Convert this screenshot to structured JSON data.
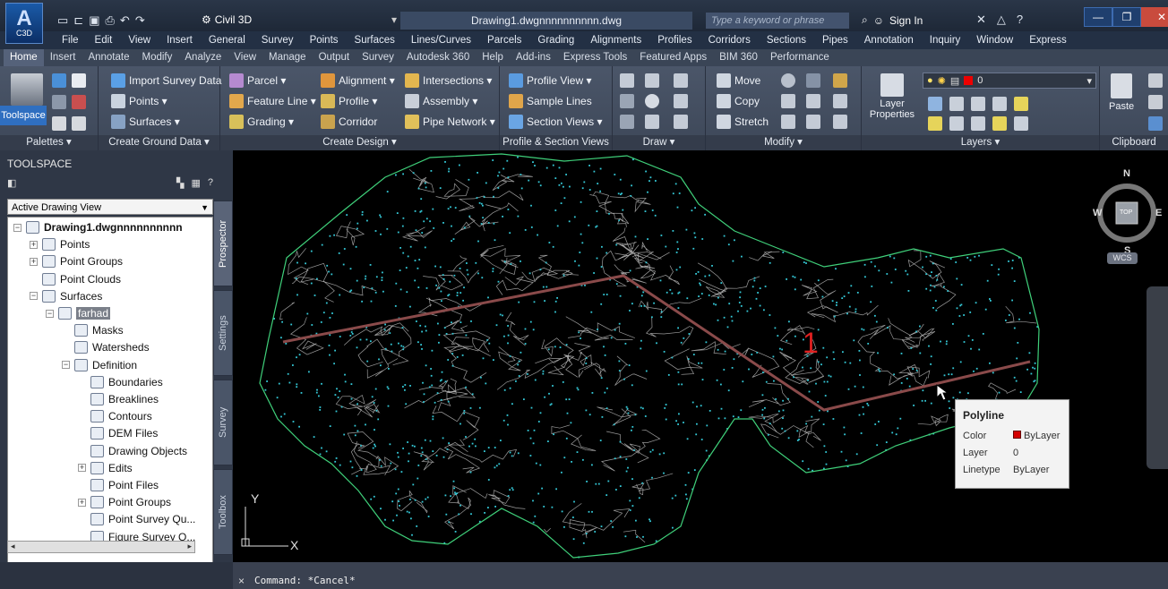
{
  "titlebar": {
    "app_logo_letter": "A",
    "app_logo_code": "C3D",
    "workspace": "Civil 3D",
    "document_title": "Drawing1.dwgnnnnnnnnnn.dwg",
    "search_placeholder": "Type a keyword or phrase",
    "sign_in": "Sign In"
  },
  "menubar": [
    "File",
    "Edit",
    "View",
    "Insert",
    "General",
    "Survey",
    "Points",
    "Surfaces",
    "Lines/Curves",
    "Parcels",
    "Grading",
    "Alignments",
    "Profiles",
    "Corridors",
    "Sections",
    "Pipes",
    "Annotation",
    "Inquiry",
    "Window",
    "Express"
  ],
  "ribbon_tabs": [
    "Home",
    "Insert",
    "Annotate",
    "Modify",
    "Analyze",
    "View",
    "Manage",
    "Output",
    "Survey",
    "Autodesk 360",
    "Help",
    "Add-ins",
    "Express Tools",
    "Featured Apps",
    "BIM 360",
    "Performance"
  ],
  "ribbon": {
    "palettes": {
      "toolspace": "Toolspace",
      "title": "Palettes ▾"
    },
    "ground": {
      "import": "Import Survey Data",
      "points": "Points ▾",
      "surfaces": "Surfaces ▾",
      "title": "Create Ground Data ▾"
    },
    "design": {
      "parcel": "Parcel ▾",
      "feature_line": "Feature Line ▾",
      "grading": "Grading ▾",
      "alignment": "Alignment ▾",
      "profile": "Profile ▾",
      "corridor": "Corridor",
      "intersections": "Intersections ▾",
      "assembly": "Assembly ▾",
      "pipe_network": "Pipe Network ▾",
      "title": "Create Design ▾"
    },
    "profile_section": {
      "profile_view": "Profile View ▾",
      "sample_lines": "Sample Lines",
      "section_views": "Section Views ▾",
      "title": "Profile & Section Views"
    },
    "draw": {
      "title": "Draw ▾"
    },
    "modify": {
      "move": "Move",
      "copy": "Copy",
      "stretch": "Stretch",
      "title": "Modify ▾"
    },
    "layers": {
      "layer_properties": "Layer Properties",
      "layer_value": "0",
      "title": "Layers ▾"
    },
    "clipboard": {
      "paste": "Paste",
      "title": "Clipboard"
    }
  },
  "toolspace": {
    "header": "TOOLSPACE",
    "view_select": "Active Drawing View",
    "side_tabs": [
      "Prospector",
      "Settings",
      "Survey",
      "Toolbox"
    ],
    "tree": [
      {
        "label": "Drawing1.dwgnnnnnnnnnn",
        "level": 0,
        "exp": "−"
      },
      {
        "label": "Points",
        "level": 1,
        "exp": "+"
      },
      {
        "label": "Point Groups",
        "level": 1,
        "exp": "+"
      },
      {
        "label": "Point Clouds",
        "level": 1,
        "exp": ""
      },
      {
        "label": "Surfaces",
        "level": 1,
        "exp": "−"
      },
      {
        "label": "farhad",
        "level": 2,
        "exp": "−",
        "selected": true
      },
      {
        "label": "Masks",
        "level": 3,
        "exp": ""
      },
      {
        "label": "Watersheds",
        "level": 3,
        "exp": ""
      },
      {
        "label": "Definition",
        "level": 3,
        "exp": "−"
      },
      {
        "label": "Boundaries",
        "level": 4,
        "exp": ""
      },
      {
        "label": "Breaklines",
        "level": 4,
        "exp": ""
      },
      {
        "label": "Contours",
        "level": 4,
        "exp": ""
      },
      {
        "label": "DEM Files",
        "level": 4,
        "exp": ""
      },
      {
        "label": "Drawing Objects",
        "level": 4,
        "exp": ""
      },
      {
        "label": "Edits",
        "level": 4,
        "exp": "+"
      },
      {
        "label": "Point Files",
        "level": 4,
        "exp": ""
      },
      {
        "label": "Point Groups",
        "level": 4,
        "exp": "+"
      },
      {
        "label": "Point Survey Qu...",
        "level": 4,
        "exp": ""
      },
      {
        "label": "Figure Survey Q...",
        "level": 4,
        "exp": ""
      }
    ]
  },
  "viewport": {
    "marker_label": "1",
    "viewcube": {
      "n": "N",
      "s": "S",
      "e": "E",
      "w": "W",
      "face": "TOP"
    },
    "wcs": "WCS",
    "ucs_y": "Y",
    "ucs_x": "X",
    "tooltip": {
      "title": "Polyline",
      "rows": [
        {
          "key": "Color",
          "value": "ByLayer",
          "swatch": "#d40000"
        },
        {
          "key": "Layer",
          "value": "0"
        },
        {
          "key": "Linetype",
          "value": "ByLayer"
        }
      ]
    },
    "colors": {
      "boundary": "#3fd07a",
      "points": "#34c8d6",
      "contours": "#cfcfcf",
      "polyline": "#8a4a4a",
      "marker": "#e02020"
    }
  },
  "command": {
    "close": "×",
    "text": "Command: *Cancel*"
  }
}
